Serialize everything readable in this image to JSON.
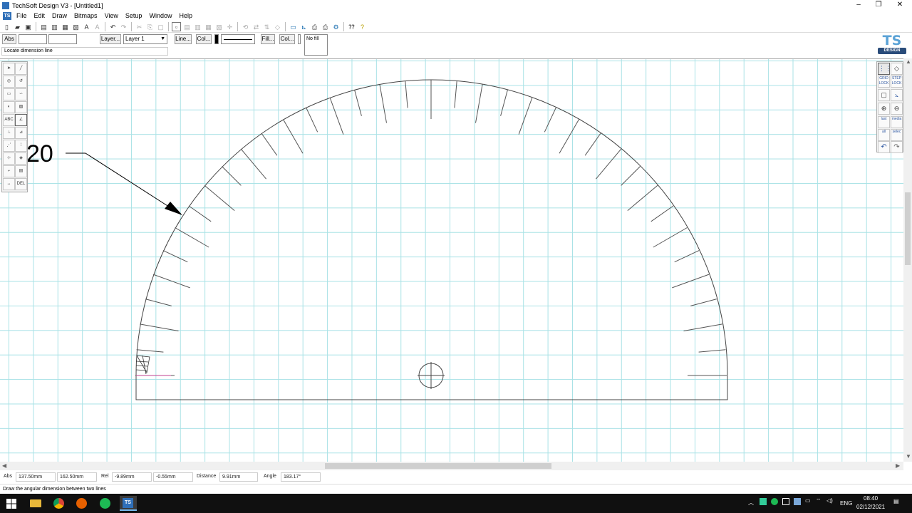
{
  "window": {
    "title": "TechSoft Design V3 - [Untitled1]"
  },
  "menu": [
    "File",
    "Edit",
    "Draw",
    "Bitmaps",
    "View",
    "Setup",
    "Window",
    "Help"
  ],
  "toolbar2": {
    "abs_label": "Abs",
    "layer_button": "Layer...",
    "layer_value": "Layer 1",
    "line_button": "Line...",
    "col_button": "Col...",
    "fill_button": "Fill...",
    "col2_button": "Col...",
    "fill_value": "No fill"
  },
  "prompt": "Locate dimension line",
  "logo": {
    "ts": "TS",
    "design": "DESIGN"
  },
  "drawing": {
    "dimension_label": "20"
  },
  "status": {
    "abs_label": "Abs",
    "abs_x": "137.50mm",
    "abs_y": "162.50mm",
    "rel_label": "Rel",
    "rel_x": "-9.89mm",
    "rel_y": "-0.55mm",
    "distance_label": "Distance",
    "distance_value": "9.91mm",
    "angle_label": "Angle",
    "angle_value": "183.17°"
  },
  "hint": "Draw the angular dimension between two lines",
  "right_tools": {
    "grid_lock": "GRID LOCK",
    "step_lock": "STEP LOCK",
    "last": "last",
    "media": "media",
    "all": "all",
    "select": "selec"
  },
  "left_tools": {
    "text_tool": "ABC",
    "del": "DEL"
  },
  "tray": {
    "language": "ENG",
    "time": "08:40",
    "date": "02/12/2021"
  },
  "colors": {
    "grid": "#a9e2e6",
    "accent": "#2f6fb8",
    "taskbar": "#101010"
  }
}
